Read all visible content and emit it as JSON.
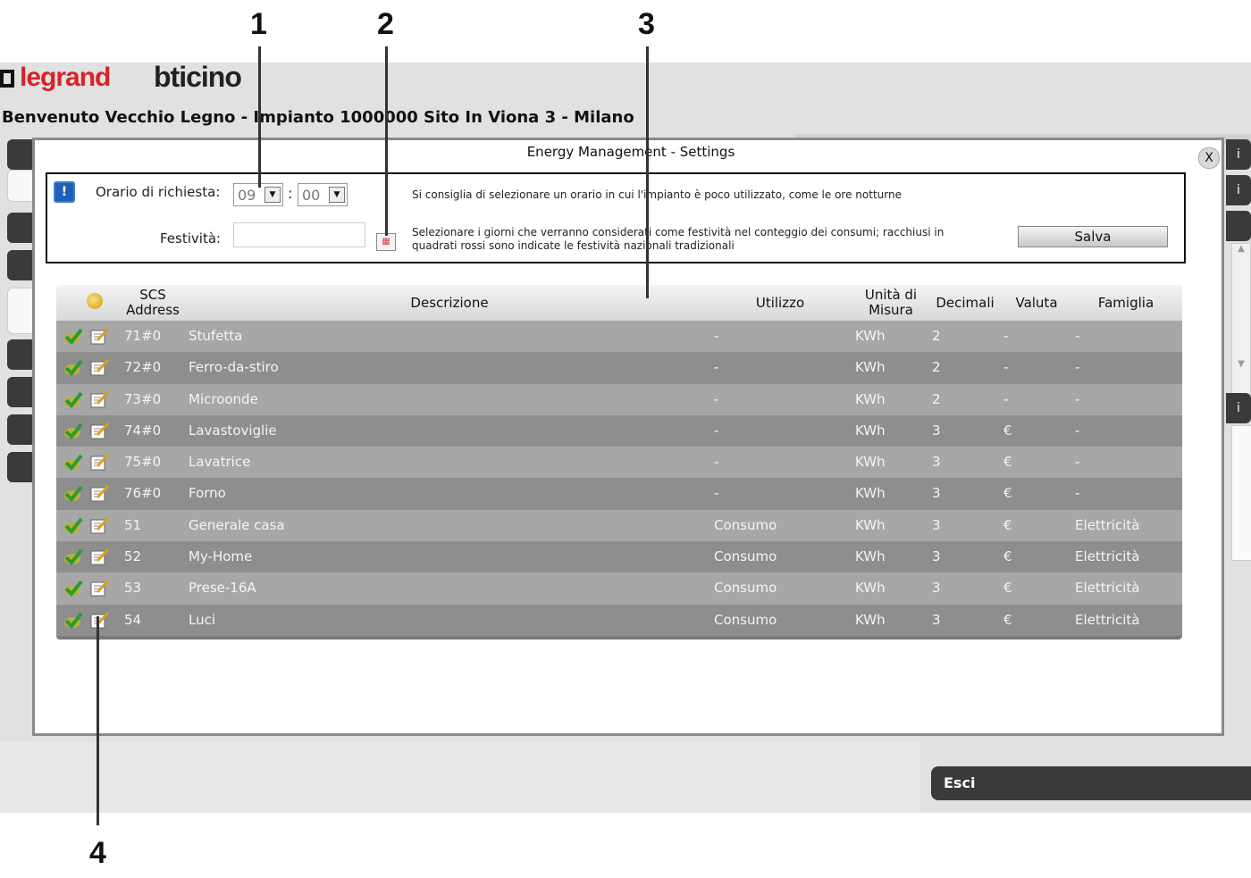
{
  "header": {
    "logo_legrand": "legrand",
    "logo_bticino": "bticino",
    "welcome": "Benvenuto Vecchio Legno - Impianto 1000000 Sito In Viona 3 - Milano"
  },
  "modal": {
    "title": "Energy Management - Settings",
    "close_label": "X"
  },
  "settings": {
    "orario_label": "Orario di richiesta:",
    "hour_value": "09",
    "minute_value": "00",
    "separator": ":",
    "festivita_label": "Festività:",
    "festivita_value": "",
    "hint_orario": "Si consiglia di selezionare un orario in cui l'impianto è poco utilizzato, come le ore notturne",
    "hint_festivita_1": "Selezionare i giorni che verranno considerati come festività nel conteggio dei consumi; racchiusi in",
    "hint_festivita_2": "quadrati rossi sono indicate le festività nazionali tradizionali",
    "save_label": "Salva"
  },
  "table": {
    "headers": {
      "scs_1": "SCS",
      "scs_2": "Address",
      "descrizione": "Descrizione",
      "utilizzo": "Utilizzo",
      "unita_1": "Unità di",
      "unita_2": "Misura",
      "decimali": "Decimali",
      "valuta": "Valuta",
      "famiglia": "Famiglia"
    },
    "rows": [
      {
        "address": "71#0",
        "descrizione": "Stufetta",
        "utilizzo": "-",
        "unita": "KWh",
        "decimali": "2",
        "valuta": "-",
        "famiglia": "-"
      },
      {
        "address": "72#0",
        "descrizione": "Ferro-da-stiro",
        "utilizzo": "-",
        "unita": "KWh",
        "decimali": "2",
        "valuta": "-",
        "famiglia": "-"
      },
      {
        "address": "73#0",
        "descrizione": "Microonde",
        "utilizzo": "-",
        "unita": "KWh",
        "decimali": "2",
        "valuta": "-",
        "famiglia": "-"
      },
      {
        "address": "74#0",
        "descrizione": "Lavastoviglie",
        "utilizzo": "-",
        "unita": "KWh",
        "decimali": "3",
        "valuta": "€",
        "famiglia": "-"
      },
      {
        "address": "75#0",
        "descrizione": "Lavatrice",
        "utilizzo": "-",
        "unita": "KWh",
        "decimali": "3",
        "valuta": "€",
        "famiglia": "-"
      },
      {
        "address": "76#0",
        "descrizione": "Forno",
        "utilizzo": "-",
        "unita": "KWh",
        "decimali": "3",
        "valuta": "€",
        "famiglia": "-"
      },
      {
        "address": "51",
        "descrizione": "Generale casa",
        "utilizzo": "Consumo",
        "unita": "KWh",
        "decimali": "3",
        "valuta": "€",
        "famiglia": "Elettricità"
      },
      {
        "address": "52",
        "descrizione": "My-Home",
        "utilizzo": "Consumo",
        "unita": "KWh",
        "decimali": "3",
        "valuta": "€",
        "famiglia": "Elettricità"
      },
      {
        "address": "53",
        "descrizione": "Prese-16A",
        "utilizzo": "Consumo",
        "unita": "KWh",
        "decimali": "3",
        "valuta": "€",
        "famiglia": "Elettricità"
      },
      {
        "address": "54",
        "descrizione": "Luci",
        "utilizzo": "Consumo",
        "unita": "KWh",
        "decimali": "3",
        "valuta": "€",
        "famiglia": "Elettricità"
      }
    ]
  },
  "footer": {
    "exit_label": "Esci"
  },
  "side": {
    "right_tab_label": "i"
  },
  "callouts": [
    "1",
    "2",
    "3",
    "4"
  ],
  "colors": {
    "row_light": "#a7a7a7",
    "row_dark": "#8e8e8e",
    "exit_bg": "#3a3a3a",
    "legrand_red": "#d8232a",
    "bticino_orange": "#e0781e"
  }
}
